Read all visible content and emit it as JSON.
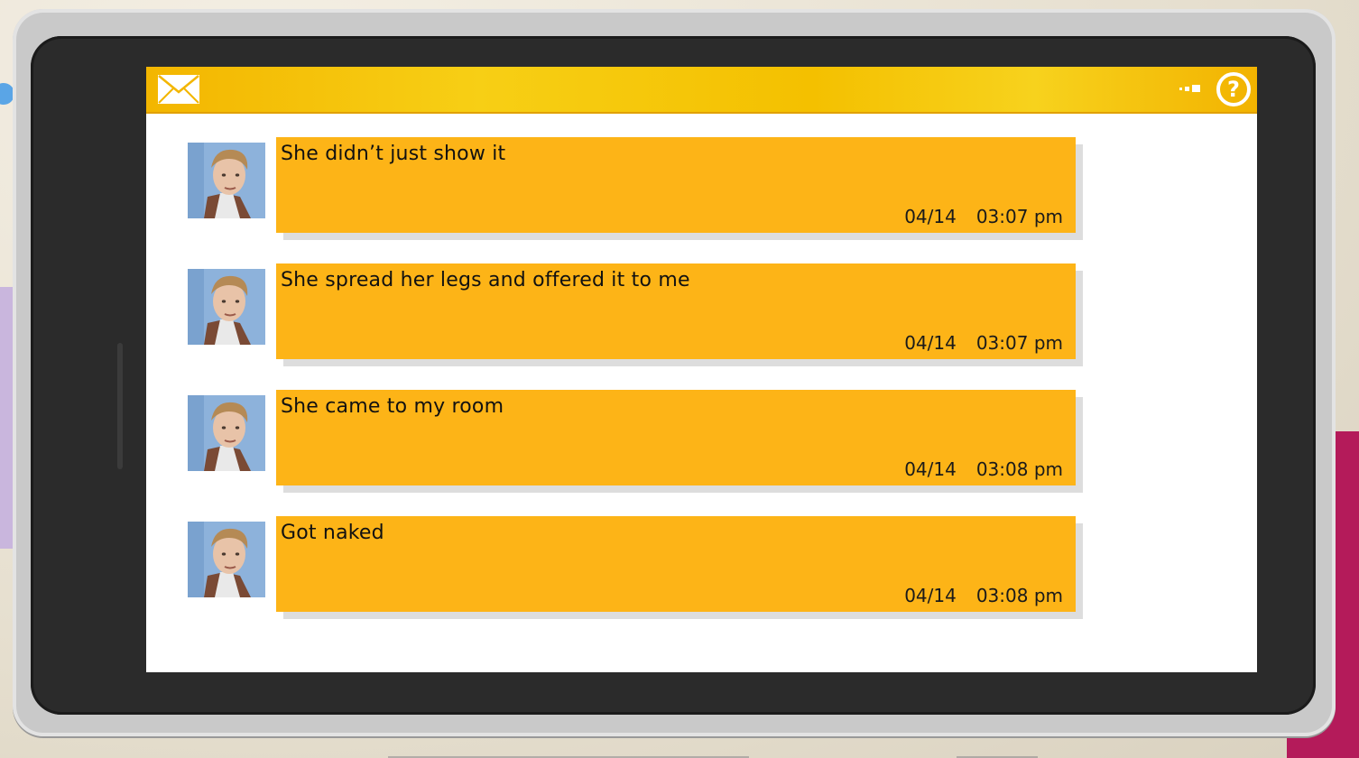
{
  "app": {
    "icons": {
      "mail": "envelope-icon",
      "signal": "signal-icon",
      "help": "question-circle-icon"
    },
    "accent_color": "#fdb417",
    "topbar_color": "#f5c400"
  },
  "messages": [
    {
      "text": "She didn’t just show it",
      "date": "04/14",
      "time": "03:07 pm"
    },
    {
      "text": "She spread her legs and offered it to me",
      "date": "04/14",
      "time": "03:07 pm"
    },
    {
      "text": "She came to my room",
      "date": "04/14",
      "time": "03:08 pm"
    },
    {
      "text": "Got naked",
      "date": "04/14",
      "time": "03:08 pm"
    }
  ]
}
